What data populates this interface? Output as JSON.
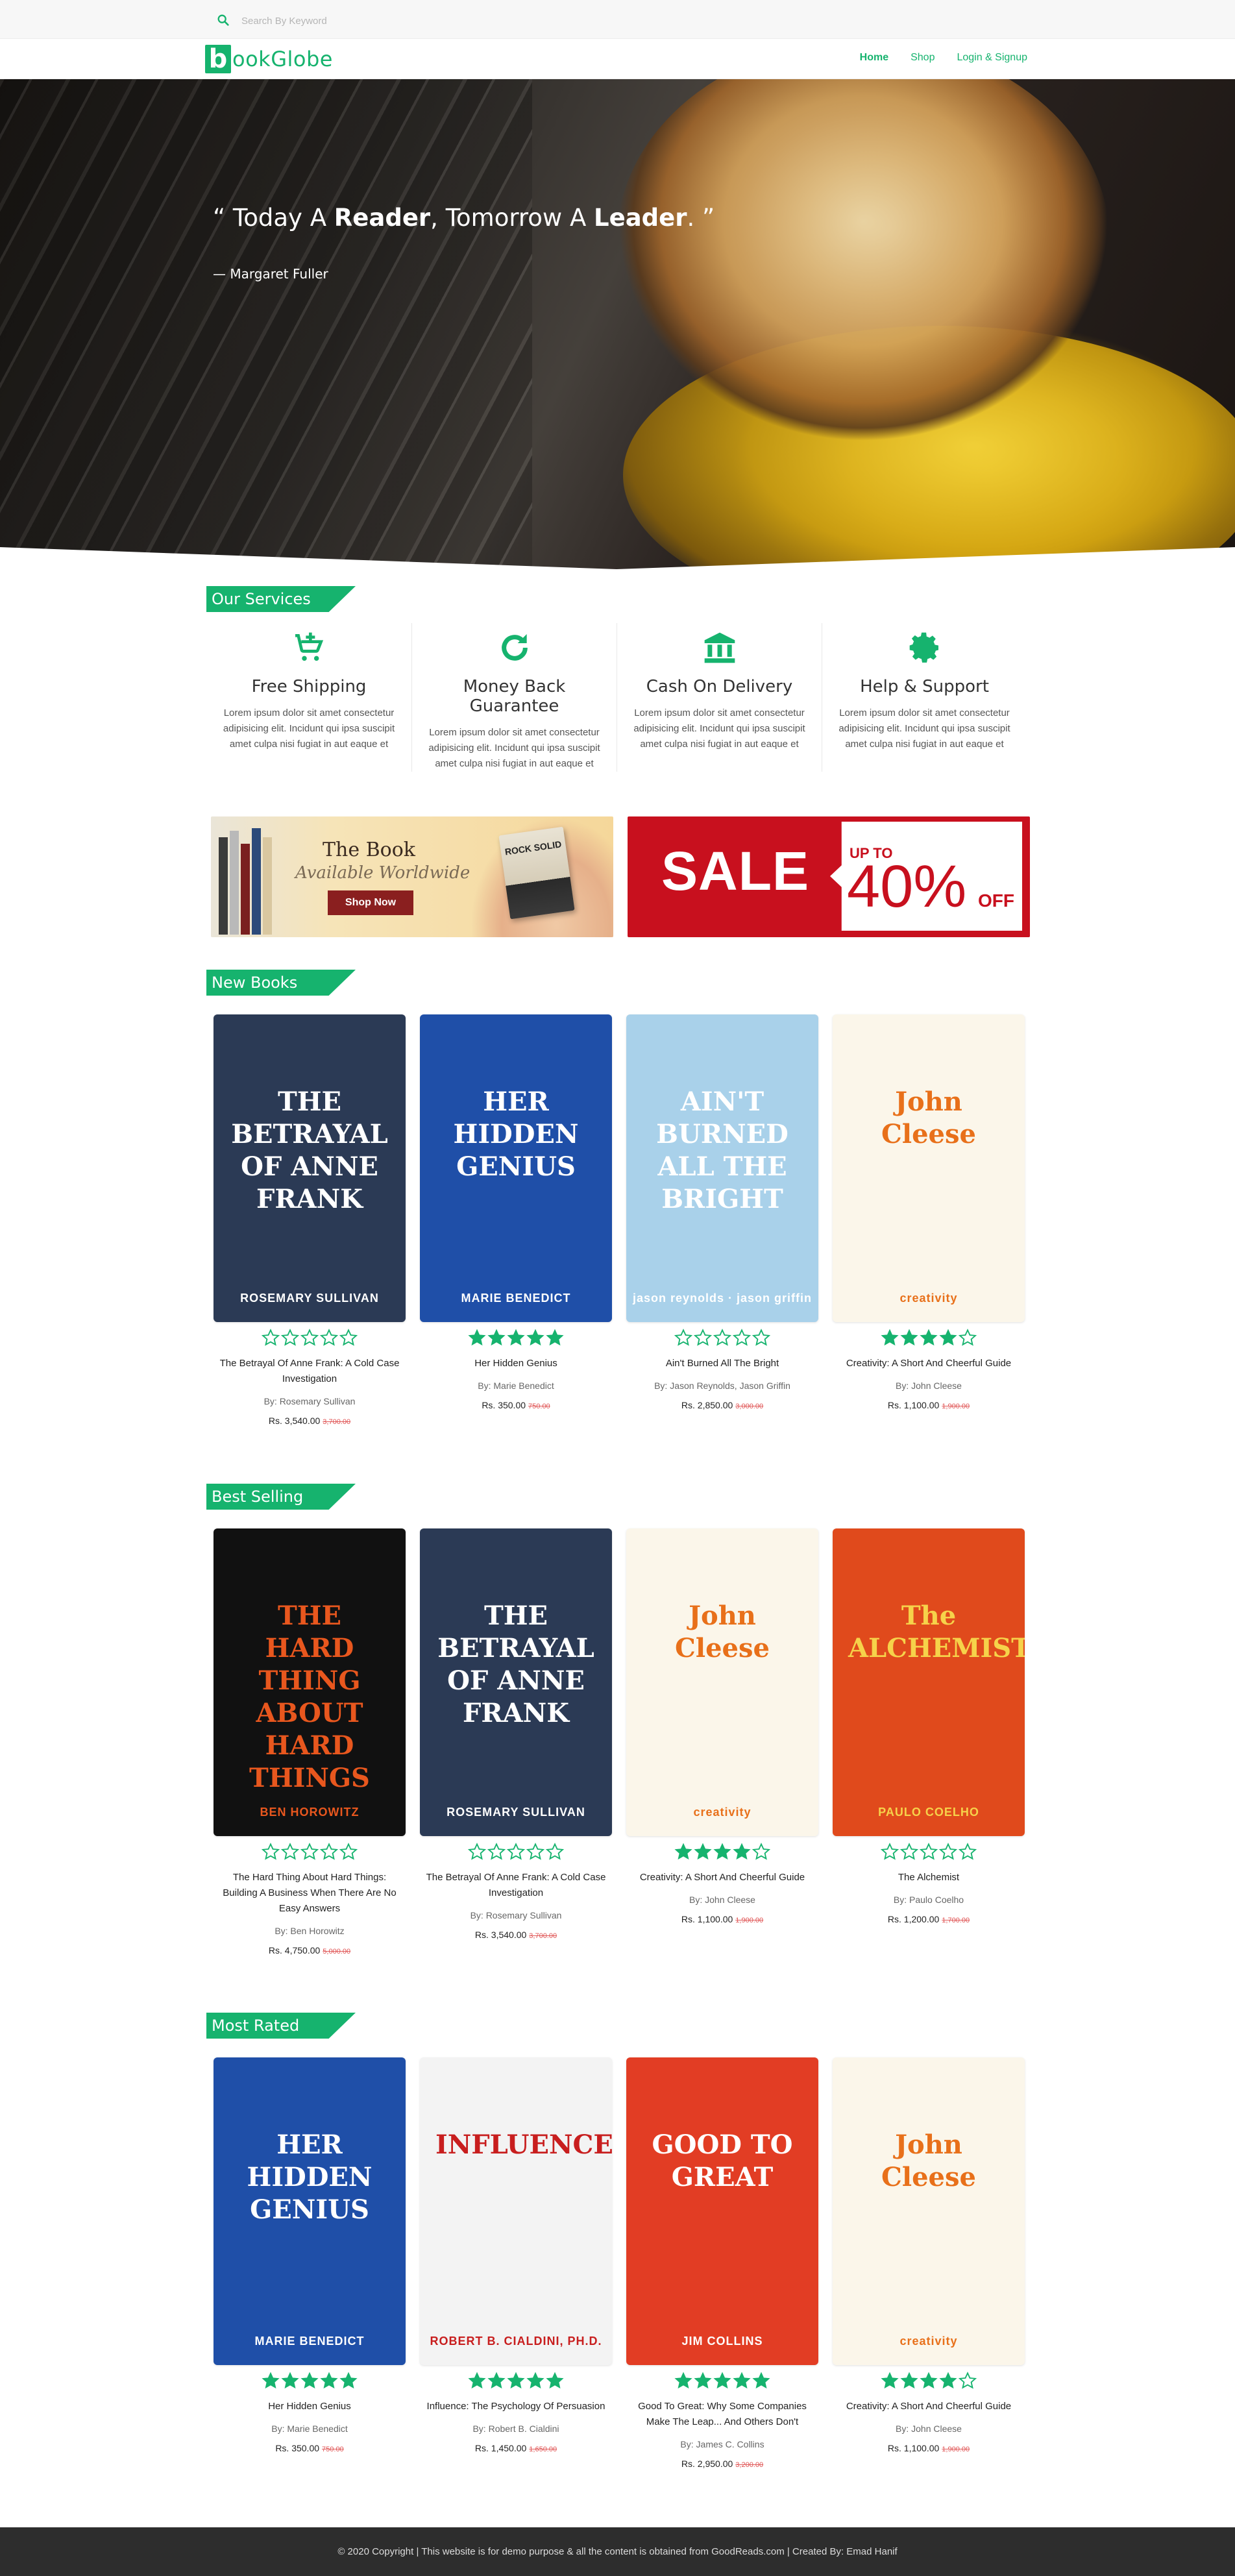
{
  "search": {
    "placeholder": "Search By Keyword"
  },
  "brand": {
    "mark": "b",
    "name": "ookGlobe"
  },
  "nav": {
    "items": [
      {
        "label": "Home",
        "active": true
      },
      {
        "label": "Shop",
        "active": false
      },
      {
        "label": "Login & Signup",
        "active": false
      }
    ]
  },
  "hero": {
    "quote_open": "“ Today A ",
    "quote_w1": "Reader",
    "quote_mid": ", Tomorrow A ",
    "quote_w2": "Leader",
    "quote_close": ". ”",
    "author": "— Margaret Fuller"
  },
  "sections": {
    "services": "Our Services",
    "new_books": "New Books",
    "best_selling": "Best Selling",
    "most_rated": "Most Rated"
  },
  "services": [
    {
      "icon": "cart-add-icon",
      "title": "Free Shipping",
      "text": "Lorem ipsum dolor sit amet consectetur adipisicing elit. Incidunt qui ipsa suscipit amet culpa nisi fugiat in aut eaque et"
    },
    {
      "icon": "refresh-icon",
      "title": "Money Back Guarantee",
      "text": "Lorem ipsum dolor sit amet consectetur adipisicing elit. Incidunt qui ipsa suscipit amet culpa nisi fugiat in aut eaque et"
    },
    {
      "icon": "bank-icon",
      "title": "Cash On Delivery",
      "text": "Lorem ipsum dolor sit amet consectetur adipisicing elit. Incidunt qui ipsa suscipit amet culpa nisi fugiat in aut eaque et"
    },
    {
      "icon": "gear-icon",
      "title": "Help & Support",
      "text": "Lorem ipsum dolor sit amet consectetur adipisicing elit. Incidunt qui ipsa suscipit amet culpa nisi fugiat in aut eaque et"
    }
  ],
  "banners": {
    "book": {
      "title": "The Book",
      "subtitle": "Available Worldwide",
      "button": "Shop Now",
      "mini_cover": "ROCK SOLID"
    },
    "sale": {
      "word": "SALE",
      "upto": "UP TO",
      "percent": "40%",
      "off": "OFF"
    }
  },
  "colors": {
    "accent": "#16b36e",
    "star": "#16b36e",
    "sale_red": "#c8101e",
    "old_price": "#e05555",
    "footer_bg": "#2d2d2d"
  },
  "new_books": [
    {
      "title": "The Betrayal Of Anne Frank: A Cold Case Investigation",
      "author": "By: Rosemary Sullivan",
      "price": "Rs. 3,540.00",
      "old_price": "3,700.00",
      "rating": 0,
      "cover": {
        "bg": "#2b3a55",
        "fg": "#ffffff",
        "text": "THE BETRAYAL OF ANNE FRANK",
        "sub": "ROSEMARY SULLIVAN"
      }
    },
    {
      "title": "Her Hidden Genius",
      "author": "By: Marie Benedict",
      "price": "Rs. 350.00",
      "old_price": "750.00",
      "rating": 5,
      "cover": {
        "bg": "#1f4fa8",
        "fg": "#ffffff",
        "text": "HER HIDDEN GENIUS",
        "sub": "MARIE BENEDICT"
      }
    },
    {
      "title": "Ain't Burned All The Bright",
      "author": "By: Jason Reynolds, Jason Griffin",
      "price": "Rs. 2,850.00",
      "old_price": "3,000.00",
      "rating": 0,
      "cover": {
        "bg": "#a9d1ea",
        "fg": "#ffffff",
        "text": "AIN'T BURNED ALL THE BRIGHT",
        "sub": "jason reynolds · jason griffin"
      }
    },
    {
      "title": "Creativity: A Short And Cheerful Guide",
      "author": "By: John Cleese",
      "price": "Rs. 1,100.00",
      "old_price": "1,900.00",
      "rating": 4,
      "cover": {
        "bg": "#fbf6ea",
        "fg": "#e8701a",
        "text": "John Cleese",
        "sub": "creativity"
      }
    }
  ],
  "best_selling": [
    {
      "title": "The Hard Thing About Hard Things: Building A Business When There Are No Easy Answers",
      "author": "By: Ben Horowitz",
      "price": "Rs. 4,750.00",
      "old_price": "5,000.00",
      "rating": 0,
      "cover": {
        "bg": "#111111",
        "fg": "#e8571e",
        "text": "THE HARD THING ABOUT HARD THINGS",
        "sub": "BEN HOROWITZ"
      }
    },
    {
      "title": "The Betrayal Of Anne Frank: A Cold Case Investigation",
      "author": "By: Rosemary Sullivan",
      "price": "Rs. 3,540.00",
      "old_price": "3,700.00",
      "rating": 0,
      "cover": {
        "bg": "#2b3a55",
        "fg": "#ffffff",
        "text": "THE BETRAYAL OF ANNE FRANK",
        "sub": "ROSEMARY SULLIVAN"
      }
    },
    {
      "title": "Creativity: A Short And Cheerful Guide",
      "author": "By: John Cleese",
      "price": "Rs. 1,100.00",
      "old_price": "1,900.00",
      "rating": 4,
      "cover": {
        "bg": "#fbf6ea",
        "fg": "#e8701a",
        "text": "John Cleese",
        "sub": "creativity"
      }
    },
    {
      "title": "The Alchemist",
      "author": "By: Paulo Coelho",
      "price": "Rs. 1,200.00",
      "old_price": "1,700.00",
      "rating": 0,
      "cover": {
        "bg": "#e04a1c",
        "fg": "#f6d24a",
        "text": "The ALCHEMIST",
        "sub": "PAULO COELHO"
      }
    }
  ],
  "most_rated": [
    {
      "title": "Her Hidden Genius",
      "author": "By: Marie Benedict",
      "price": "Rs. 350.00",
      "old_price": "750.00",
      "rating": 5,
      "cover": {
        "bg": "#1f4fa8",
        "fg": "#ffffff",
        "text": "HER HIDDEN GENIUS",
        "sub": "MARIE BENEDICT"
      }
    },
    {
      "title": "Influence: The Psychology Of Persuasion",
      "author": "By: Robert B. Cialdini",
      "price": "Rs. 1,450.00",
      "old_price": "1,650.00",
      "rating": 5,
      "cover": {
        "bg": "#f3f3f3",
        "fg": "#c81e1e",
        "text": "INFLUENCE",
        "sub": "ROBERT B. CIALDINI, PH.D."
      }
    },
    {
      "title": "Good To Great: Why Some Companies Make The Leap... And Others Don't",
      "author": "By: James C. Collins",
      "price": "Rs. 2,950.00",
      "old_price": "3,200.00",
      "rating": 5,
      "cover": {
        "bg": "#e23d24",
        "fg": "#ffffff",
        "text": "GOOD TO GREAT",
        "sub": "JIM COLLINS"
      }
    },
    {
      "title": "Creativity: A Short And Cheerful Guide",
      "author": "By: John Cleese",
      "price": "Rs. 1,100.00",
      "old_price": "1,900.00",
      "rating": 4,
      "cover": {
        "bg": "#fbf6ea",
        "fg": "#e8701a",
        "text": "John Cleese",
        "sub": "creativity"
      }
    }
  ],
  "footer": {
    "text": "© 2020 Copyright | This website is for demo purpose & all the content is obtained from GoodReads.com | Created By: Emad Hanif"
  }
}
